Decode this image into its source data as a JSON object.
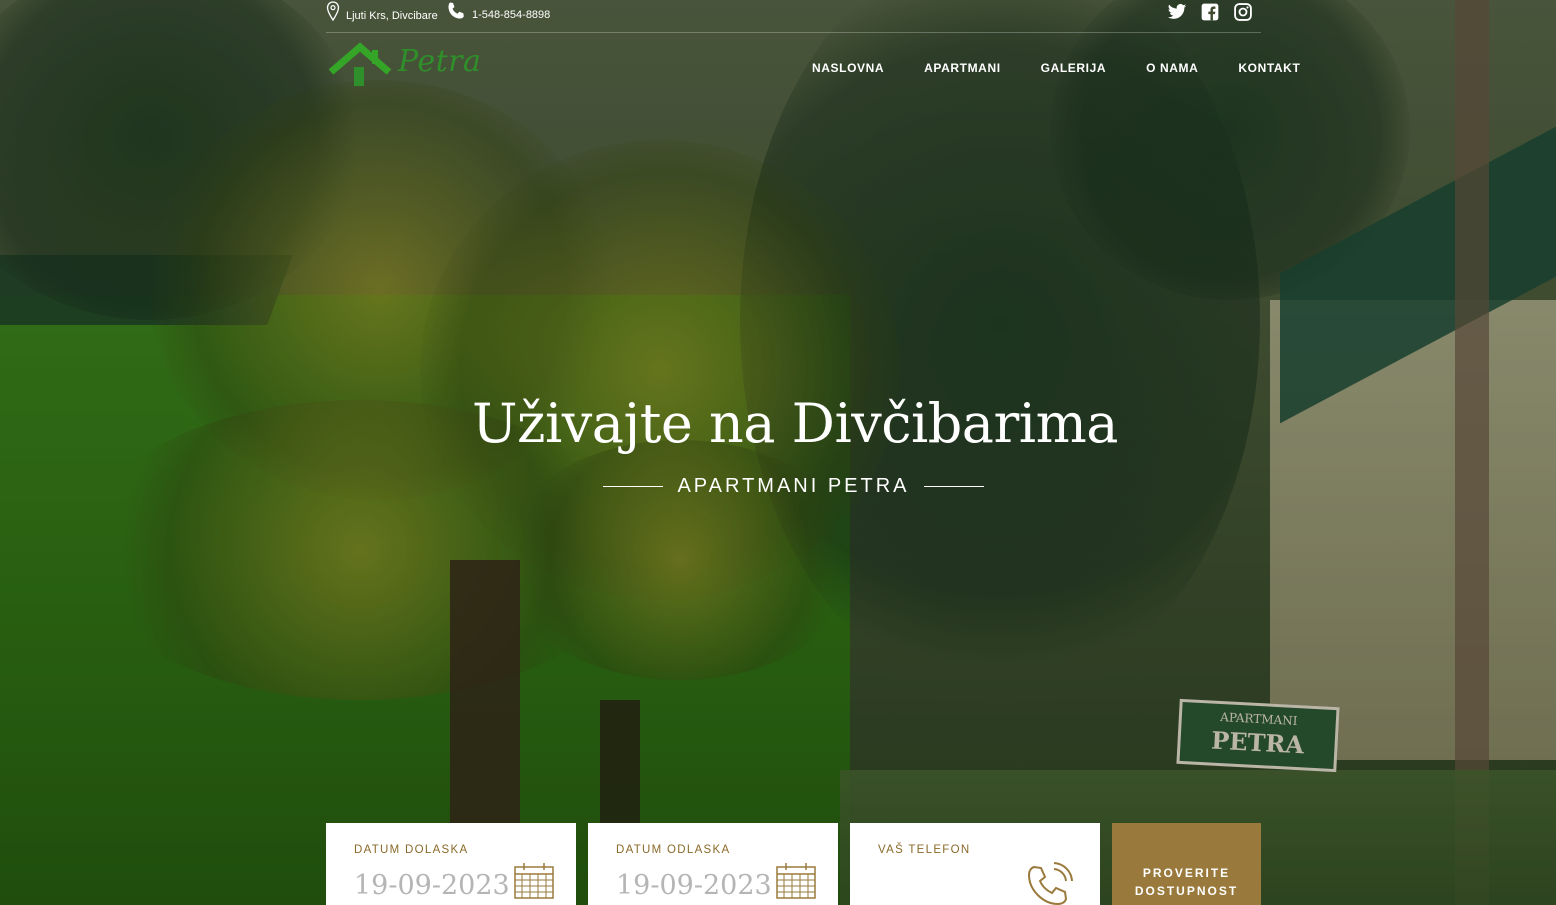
{
  "topbar": {
    "address": "Ljuti Krs, Divcibare",
    "phone": "1-548-854-8898",
    "social": [
      "twitter-icon",
      "facebook-icon",
      "instagram-icon"
    ]
  },
  "logo": {
    "text": "Petra"
  },
  "nav": {
    "items": [
      "NASLOVNA",
      "APARTMANI",
      "GALERIJA",
      "O NAMA",
      "KONTAKT"
    ]
  },
  "hero": {
    "title": "Uživajte na Divčibarima",
    "subtitle": "APARTMANI PETRA",
    "sign_top": "APARTMANI",
    "sign_main": "PETRA"
  },
  "booking": {
    "arrival_label": "DATUM DOLASKA",
    "arrival_value": "19-09-2023",
    "departure_label": "DATUM ODLASKA",
    "departure_value": "19-09-2023",
    "phone_label": "VAŠ TELEFON",
    "phone_value": "",
    "submit_line1": "PROVERITE",
    "submit_line2": "DOSTUPNOST"
  },
  "colors": {
    "accent": "#9a7a3c",
    "label": "#8a6a2a",
    "logo_green": "#2f8f2a"
  }
}
